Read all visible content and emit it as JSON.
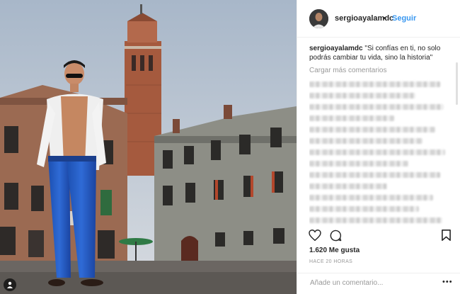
{
  "post": {
    "username": "sergioayalamdc",
    "separator": "•",
    "follow_label": "Seguir",
    "caption_user": "sergioayalamdc",
    "caption_text": " \"Si confías en ti, no solo podrás cambiar tu vida, sino la historia\"",
    "load_more_label": "Cargar más comentarios",
    "likes": "1.620 Me gusta",
    "time": "HACE 20 HORAS",
    "add_comment_placeholder": "Añade un comentario...",
    "more_label": "•••"
  },
  "icons": {
    "like": "heart-icon",
    "comment": "comment-icon",
    "save": "bookmark-icon",
    "user_tag": "person-icon"
  },
  "colors": {
    "link": "#3897f0",
    "text": "#262626",
    "muted": "#999999"
  }
}
